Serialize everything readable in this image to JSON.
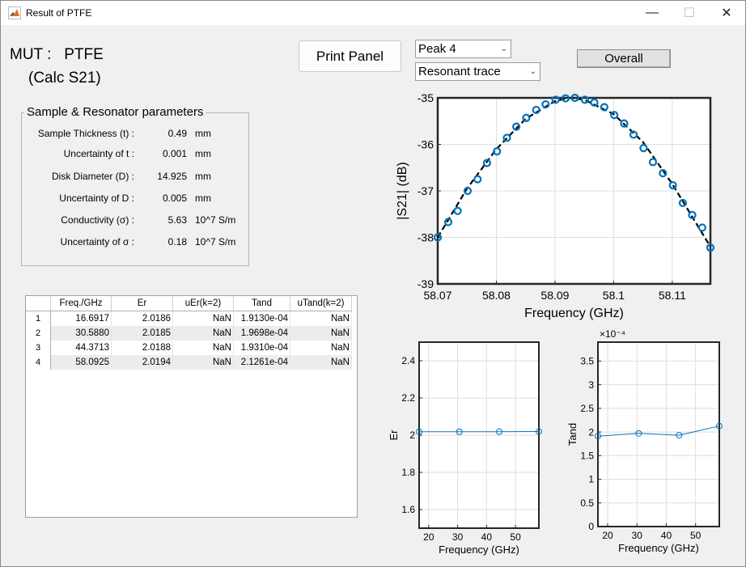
{
  "window": {
    "title": "Result of PTFE",
    "controls": {
      "minimize": "—",
      "maximize": "☐",
      "close": "✕"
    }
  },
  "header": {
    "mut_label": "MUT :   PTFE",
    "calc_label": "(Calc S21)",
    "print_button": "Print Panel",
    "peak_select": "Peak 4",
    "trace_select": "Resonant trace",
    "overall_button": "Overall"
  },
  "params": {
    "title": "Sample & Resonator parameters",
    "rows": [
      {
        "label": "Sample Thickness (t) :",
        "value": "0.49",
        "unit": "mm"
      },
      {
        "label": "Uncertainty of t :",
        "value": "0.001",
        "unit": "mm"
      },
      {
        "label": "Disk Diameter (D) :",
        "value": "14.925",
        "unit": "mm"
      },
      {
        "label": "Uncertainty of D :",
        "value": "0.005",
        "unit": "mm"
      },
      {
        "label": "Conductivity (σ) :",
        "value": "5.63",
        "unit": "10^7 S/m"
      },
      {
        "label": "Uncertainty of σ :",
        "value": "0.18",
        "unit": "10^7 S/m"
      }
    ]
  },
  "table": {
    "columns": [
      "Freq./GHz",
      "Er",
      "uEr(k=2)",
      "Tand",
      "uTand(k=2)"
    ],
    "rows": [
      {
        "n": "1",
        "cells": [
          "16.6917",
          "2.0186",
          "NaN",
          "1.9130e-04",
          "NaN"
        ]
      },
      {
        "n": "2",
        "cells": [
          "30.5880",
          "2.0185",
          "NaN",
          "1.9698e-04",
          "NaN"
        ]
      },
      {
        "n": "3",
        "cells": [
          "44.3713",
          "2.0188",
          "NaN",
          "1.9310e-04",
          "NaN"
        ]
      },
      {
        "n": "4",
        "cells": [
          "58.0925",
          "2.0194",
          "NaN",
          "2.1261e-04",
          "NaN"
        ]
      }
    ]
  },
  "chart_data": [
    {
      "type": "scatter",
      "name": "resonant-trace",
      "xlabel": "Frequency (GHz)",
      "ylabel": "|S21| (dB)",
      "xlim": [
        58.07,
        58.1165
      ],
      "ylim": [
        -39,
        -35
      ],
      "xticks": [
        "58.07",
        "58.08",
        "58.09",
        "58.1",
        "58.11"
      ],
      "yticks": [
        "-35",
        "-36",
        "-37",
        "-38",
        "-39"
      ],
      "grid": true,
      "measured_color": "#0072bd",
      "fit_color": "#000000",
      "measured": {
        "x": [
          58.07,
          58.0718,
          58.0734,
          58.0751,
          58.0768,
          58.0784,
          58.0801,
          58.0818,
          58.0834,
          58.0851,
          58.0868,
          58.0884,
          58.0901,
          58.0918,
          58.0934,
          58.0951,
          58.0967,
          58.0984,
          58.1001,
          58.1018,
          58.1034,
          58.1051,
          58.1067,
          58.1084,
          58.1101,
          58.1118,
          58.1134,
          58.1151,
          58.1165
        ],
        "y": [
          -38.0,
          -37.67,
          -37.43,
          -37.0,
          -36.75,
          -36.4,
          -36.15,
          -35.86,
          -35.62,
          -35.43,
          -35.26,
          -35.14,
          -35.04,
          -35.01,
          -35.0,
          -35.04,
          -35.1,
          -35.2,
          -35.37,
          -35.55,
          -35.79,
          -36.08,
          -36.38,
          -36.62,
          -36.88,
          -37.26,
          -37.52,
          -37.79,
          -38.22
        ]
      },
      "fit": {
        "x": [
          58.07,
          58.075,
          58.08,
          58.085,
          58.09,
          58.0925,
          58.095,
          58.1,
          58.105,
          58.11,
          58.1165
        ],
        "y": [
          -38.0,
          -36.95,
          -36.1,
          -35.45,
          -35.07,
          -35.0,
          -35.04,
          -35.35,
          -35.95,
          -36.85,
          -38.2
        ]
      }
    },
    {
      "type": "line",
      "name": "er-vs-frequency",
      "xlabel": "Frequency (GHz)",
      "ylabel": "Er",
      "xlim": [
        16.69,
        58.09
      ],
      "ylim": [
        1.5,
        2.5
      ],
      "xticks": [
        "20",
        "30",
        "40",
        "50"
      ],
      "yticks": [
        "1.6",
        "1.8",
        "2",
        "2.2",
        "2.4"
      ],
      "grid": true,
      "color": "#0072bd",
      "x": [
        16.6917,
        30.588,
        44.3713,
        58.0925
      ],
      "y": [
        2.0186,
        2.0185,
        2.0188,
        2.0194
      ]
    },
    {
      "type": "line",
      "name": "tand-vs-frequency",
      "xlabel": "Frequency (GHz)",
      "ylabel": "Tand",
      "exponent_label": "×10⁻⁴",
      "xlim": [
        16.69,
        58.09
      ],
      "ylim": [
        0,
        3.9
      ],
      "xticks": [
        "20",
        "30",
        "40",
        "50"
      ],
      "yticks": [
        "0",
        "0.5",
        "1",
        "1.5",
        "2",
        "2.5",
        "3",
        "3.5"
      ],
      "grid": true,
      "color": "#0072bd",
      "x": [
        16.6917,
        30.588,
        44.3713,
        58.0925
      ],
      "y": [
        1.913,
        1.9698,
        1.931,
        2.1261
      ]
    }
  ]
}
